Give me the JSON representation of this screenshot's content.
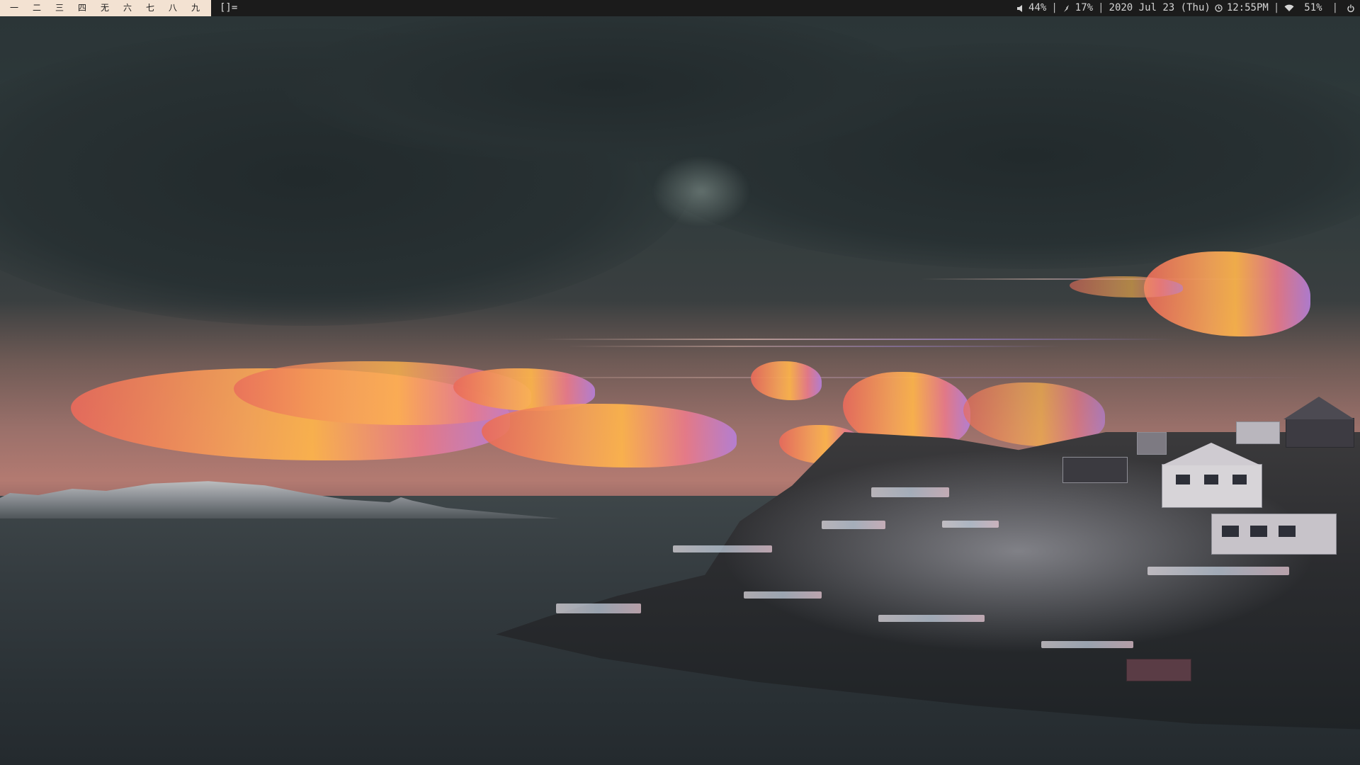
{
  "topbar": {
    "tags": [
      "一",
      "二",
      "三",
      "四",
      "无",
      "六",
      "七",
      "八",
      "九"
    ],
    "layout_symbol": "[]=",
    "status": {
      "volume": "44%",
      "brightness": "17%",
      "date": "2020 Jul 23 (Thu)",
      "time": "12:55PM",
      "wifi": "51%",
      "separator": "|"
    },
    "icons": {
      "volume": "speaker-icon",
      "brightness": "brightness-icon",
      "clock": "clock-icon",
      "wifi": "wifi-icon",
      "power": "power-icon"
    }
  },
  "colors": {
    "bar_bg": "#1b1b1b",
    "tags_bg": "#f3e2d2",
    "text": "#d5d5d5"
  }
}
